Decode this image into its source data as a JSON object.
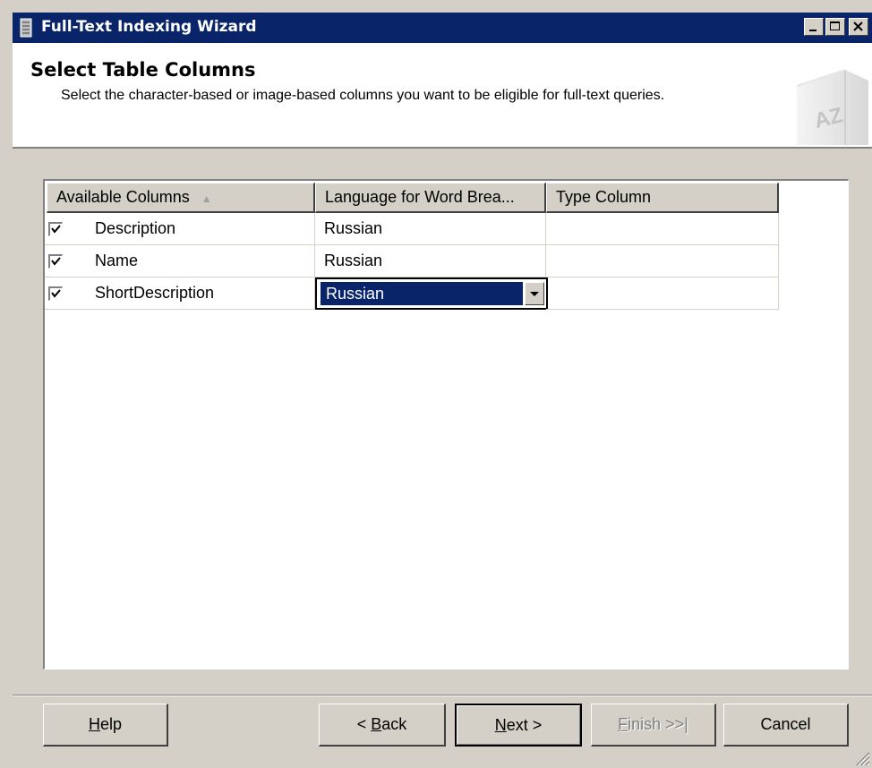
{
  "window": {
    "title": "Full-Text Indexing Wizard",
    "buttons": [
      "minimize-icon",
      "maximize-icon",
      "close-icon"
    ]
  },
  "header": {
    "title": "Select Table Columns",
    "description": "Select the character-based or image-based columns you want to be eligible for full-text queries.",
    "icon": "az-book-icon"
  },
  "grid": {
    "columns": [
      "Available Columns",
      "Language for Word Brea...",
      "Type Column"
    ],
    "sort_indicator": "▲",
    "rows": [
      {
        "checked": true,
        "name": "Description",
        "language": "Russian",
        "type_column": ""
      },
      {
        "checked": true,
        "name": "Name",
        "language": "Russian",
        "type_column": ""
      },
      {
        "checked": true,
        "name": "ShortDescription",
        "language": "Russian",
        "type_column": ""
      }
    ]
  },
  "footer": {
    "help": "Help",
    "back": "< Back",
    "next": "Next >",
    "finish": "Finish >>|",
    "cancel": "Cancel"
  },
  "colors": {
    "titlebar": "#0a246a",
    "face": "#d4d0c8",
    "selection": "#0a246a"
  }
}
